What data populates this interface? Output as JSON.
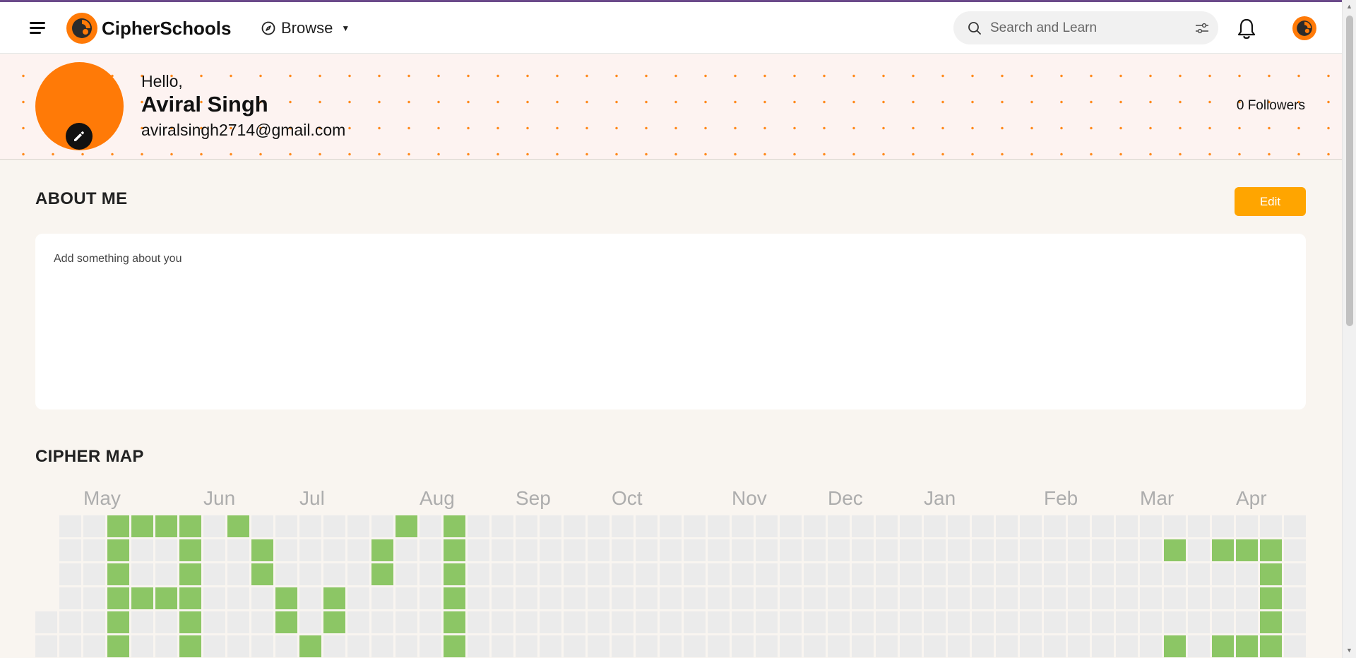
{
  "header": {
    "menu_icon": "hamburger-menu-icon",
    "logo_text": "CipherSchools",
    "browse_label": "Browse",
    "search_placeholder": "Search and Learn",
    "filter_icon": "sliders-icon",
    "bell_icon": "bell-icon"
  },
  "profile": {
    "greeting": "Hello,",
    "name": "Aviral Singh",
    "email": "aviralsingh2714@gmail.com",
    "followers": "0 Followers"
  },
  "about": {
    "title": "ABOUT ME",
    "edit_label": "Edit",
    "placeholder_text": "Add something about you"
  },
  "cipher_map": {
    "title": "CIPHER MAP",
    "months": [
      "May",
      "Jun",
      "Jul",
      "Aug",
      "Sep",
      "Oct",
      "Nov",
      "Dec",
      "Jan",
      "Feb",
      "Mar",
      "Apr"
    ],
    "weeks": 53,
    "active_cells": [
      [
        3,
        0
      ],
      [
        4,
        0
      ],
      [
        5,
        0
      ],
      [
        6,
        0
      ],
      [
        8,
        0
      ],
      [
        15,
        0
      ],
      [
        17,
        0
      ],
      [
        3,
        1
      ],
      [
        6,
        1
      ],
      [
        9,
        1
      ],
      [
        14,
        1
      ],
      [
        17,
        1
      ],
      [
        47,
        1
      ],
      [
        49,
        1
      ],
      [
        50,
        1
      ],
      [
        51,
        1
      ],
      [
        3,
        2
      ],
      [
        6,
        2
      ],
      [
        9,
        2
      ],
      [
        14,
        2
      ],
      [
        17,
        2
      ],
      [
        51,
        2
      ],
      [
        3,
        3
      ],
      [
        4,
        3
      ],
      [
        5,
        3
      ],
      [
        6,
        3
      ],
      [
        10,
        3
      ],
      [
        12,
        3
      ],
      [
        17,
        3
      ],
      [
        51,
        3
      ],
      [
        3,
        4
      ],
      [
        6,
        4
      ],
      [
        10,
        4
      ],
      [
        12,
        4
      ],
      [
        17,
        4
      ],
      [
        51,
        4
      ],
      [
        3,
        5
      ],
      [
        6,
        5
      ],
      [
        11,
        5
      ],
      [
        17,
        5
      ],
      [
        47,
        5
      ],
      [
        49,
        5
      ],
      [
        50,
        5
      ],
      [
        51,
        5
      ]
    ],
    "inactive_cells": [
      [
        0,
        0
      ],
      [
        0,
        1
      ],
      [
        0,
        2
      ],
      [
        0,
        3
      ]
    ],
    "colors": {
      "active": "#8cc665",
      "empty": "#ebebeb"
    }
  },
  "colors": {
    "brand_orange": "#ff7a07",
    "edit_button": "#ffa500",
    "top_accent": "#6b4a8a"
  }
}
